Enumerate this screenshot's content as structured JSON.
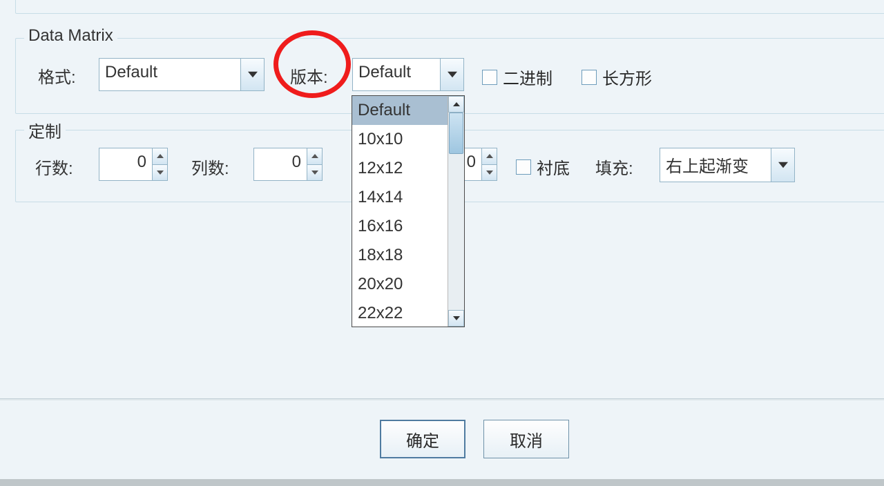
{
  "datamatrix": {
    "legend": "Data Matrix",
    "format_label": "格式:",
    "format_value": "Default",
    "version_label": "版本:",
    "version_value": "Default",
    "binary_label": "二进制",
    "rectangle_label": "长方形",
    "version_options": [
      "Default",
      "10x10",
      "12x12",
      "14x14",
      "16x16",
      "18x18",
      "20x20",
      "22x22"
    ]
  },
  "custom": {
    "legend": "定制",
    "rows_label": "行数:",
    "rows_value": "0",
    "cols_label": "列数:",
    "cols_value": "0",
    "hidden_spin_value": "0",
    "substrate_label": "衬底",
    "fill_label": "填充:",
    "fill_value": "右上起渐变"
  },
  "footer": {
    "ok": "确定",
    "cancel": "取消"
  }
}
